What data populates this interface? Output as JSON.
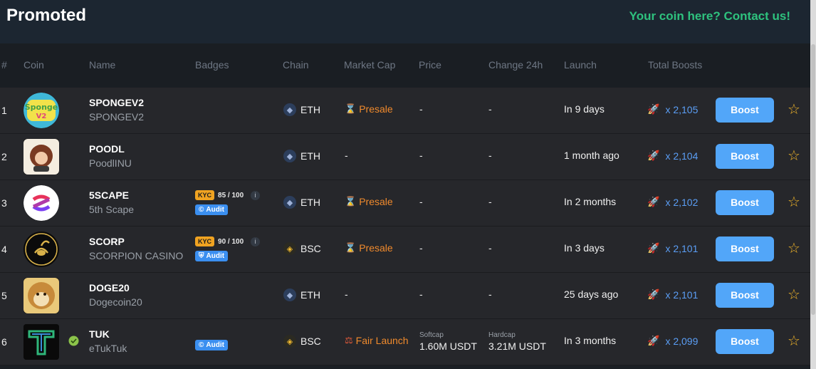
{
  "header": {
    "title": "Promoted",
    "contact": "Your coin here? Contact us!"
  },
  "columns": [
    "#",
    "Coin",
    "Name",
    "Badges",
    "Chain",
    "Market Cap",
    "Price",
    "Change 24h",
    "Launch",
    "Total Boosts"
  ],
  "boost_label": "Boost",
  "rows": [
    {
      "num": "1",
      "logo": "spongev2-logo",
      "symbol": "SPONGEV2",
      "name": "SPONGEV2",
      "kyc": null,
      "audit": null,
      "chain": "ETH",
      "chain_icon": "ethereum-icon",
      "market_cap": "Presale",
      "market_cap_icon": "hourglass-icon",
      "price": "-",
      "change": "-",
      "launch": "In 9 days",
      "boosts": "x 2,105"
    },
    {
      "num": "2",
      "logo": "poodl-logo",
      "symbol": "POODL",
      "name": "PoodlINU",
      "kyc": null,
      "audit": null,
      "chain": "ETH",
      "chain_icon": "ethereum-icon",
      "market_cap": "-",
      "market_cap_icon": null,
      "price": "-",
      "change": "-",
      "launch": "1 month ago",
      "boosts": "x 2,104"
    },
    {
      "num": "3",
      "logo": "5scape-logo",
      "symbol": "5SCAPE",
      "name": "5th Scape",
      "kyc": {
        "label": "KYC",
        "score": "85 / 100",
        "info": "i"
      },
      "audit": "Audit",
      "chain": "ETH",
      "chain_icon": "ethereum-icon",
      "market_cap": "Presale",
      "market_cap_icon": "hourglass-icon",
      "price": "-",
      "change": "-",
      "launch": "In 2 months",
      "boosts": "x 2,102"
    },
    {
      "num": "4",
      "logo": "scorp-logo",
      "symbol": "SCORP",
      "name": "SCORPION CASINO",
      "kyc": {
        "label": "KYC",
        "score": "90 / 100",
        "info": "i"
      },
      "audit": "Audit",
      "chain": "BSC",
      "chain_icon": "bnb-icon",
      "market_cap": "Presale",
      "market_cap_icon": "hourglass-icon",
      "price": "-",
      "change": "-",
      "launch": "In 3 days",
      "boosts": "x 2,101"
    },
    {
      "num": "5",
      "logo": "doge20-logo",
      "symbol": "DOGE20",
      "name": "Dogecoin20",
      "kyc": null,
      "audit": null,
      "chain": "ETH",
      "chain_icon": "ethereum-icon",
      "market_cap": "-",
      "market_cap_icon": null,
      "price": "-",
      "change": "-",
      "launch": "25 days ago",
      "boosts": "x 2,101"
    },
    {
      "num": "6",
      "logo": "tuk-logo",
      "symbol": "TUK",
      "name": "eTukTuk",
      "kyc": null,
      "audit": "Audit",
      "chain": "BSC",
      "chain_icon": "bnb-icon",
      "market_cap": "Fair Launch",
      "market_cap_icon": "scale-icon",
      "price_label": "Softcap",
      "price": "1.60M USDT",
      "change_label": "Hardcap",
      "change": "3.21M USDT",
      "launch": "In 3 months",
      "boosts": "x 2,099"
    }
  ],
  "colors": {
    "accent_blue": "#52a6f9",
    "contact_green": "#2ec27e",
    "presale_orange": "#f08a2c",
    "kyc_yellow": "#f0a321",
    "star_gold": "#f0b429"
  }
}
